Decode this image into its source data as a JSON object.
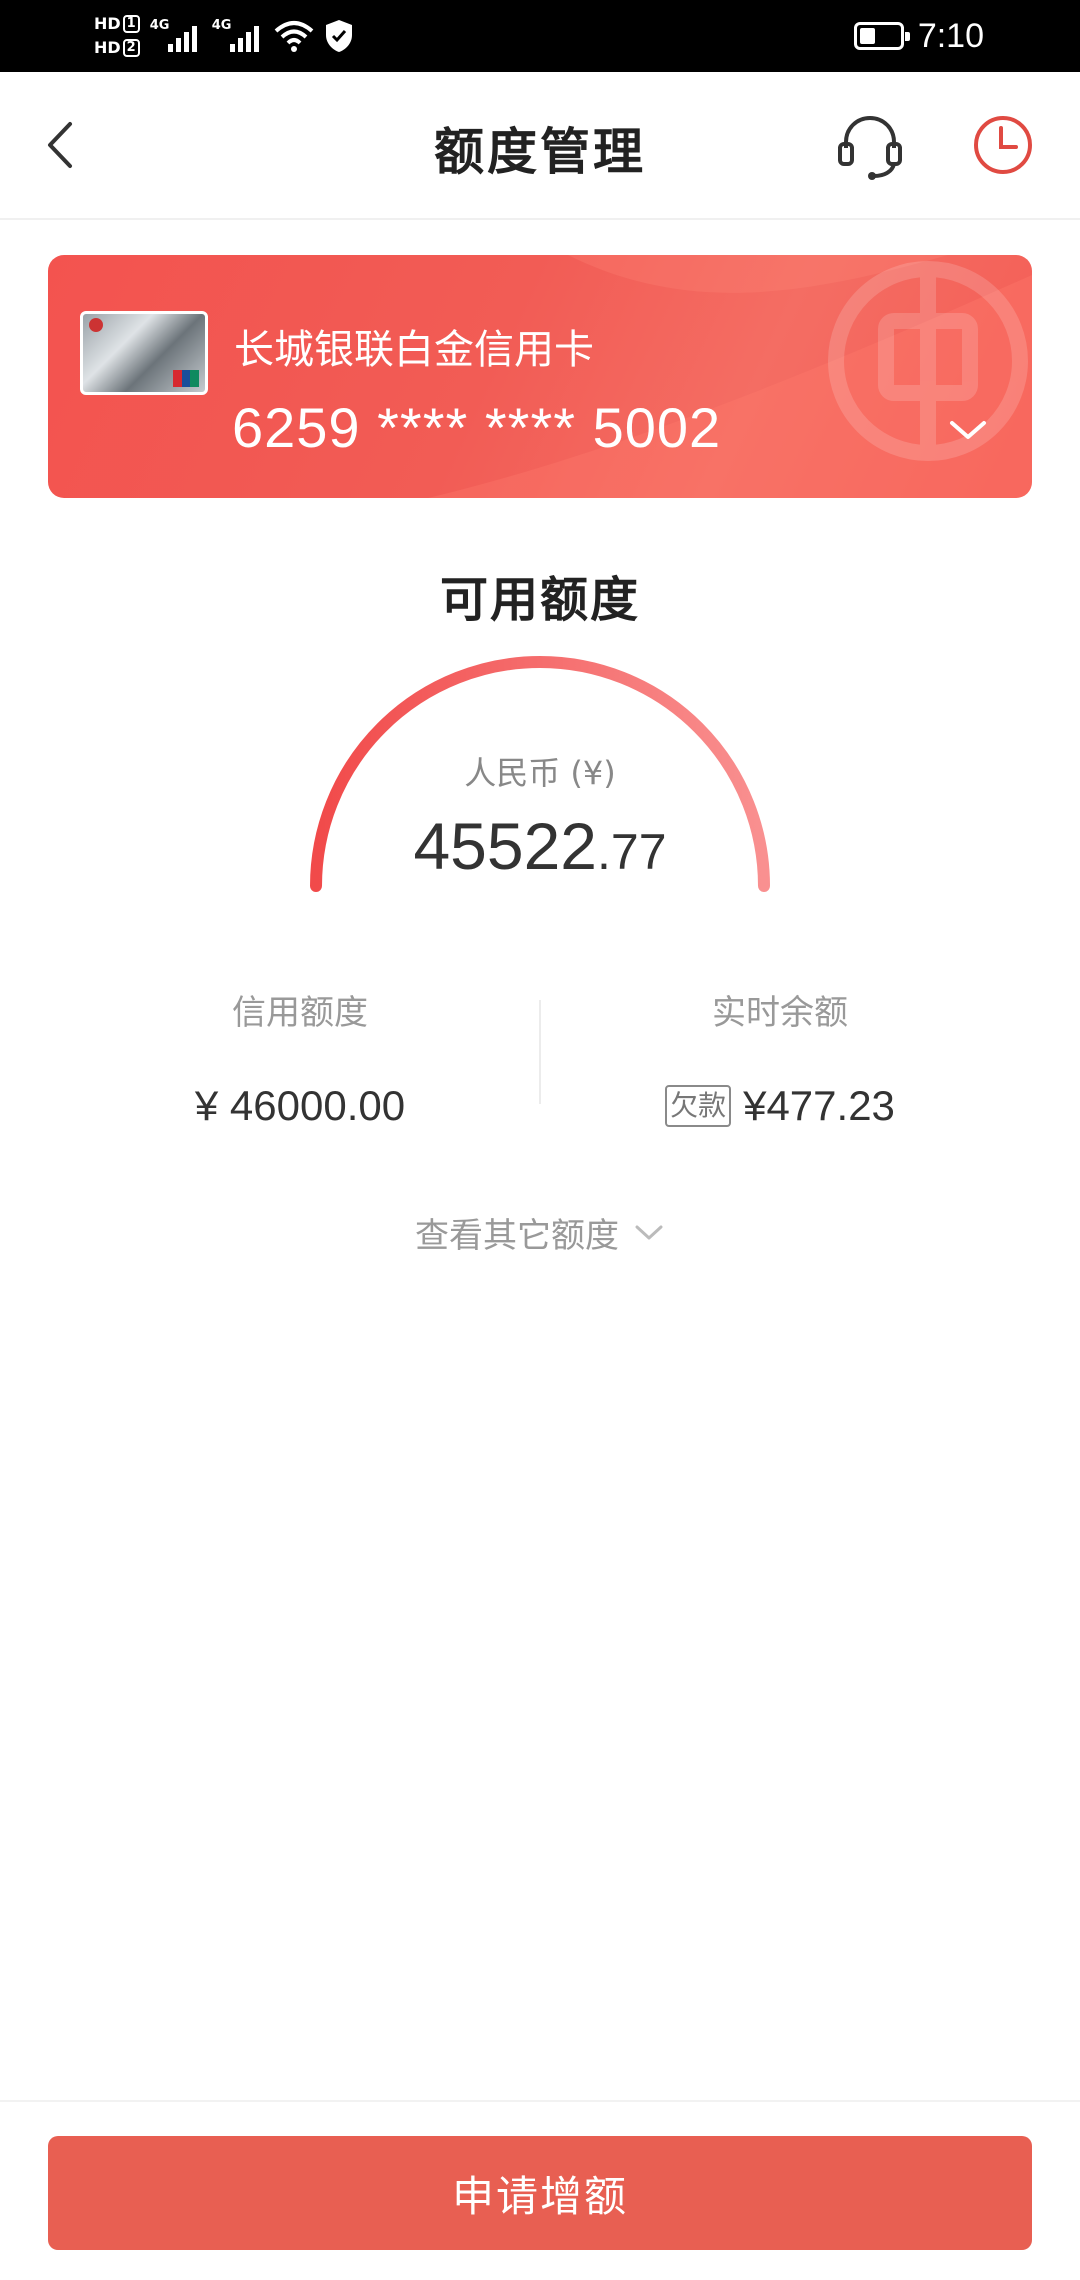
{
  "status_bar": {
    "hd1": "HD",
    "hd1_sub": "1",
    "hd2": "HD",
    "hd2_sub": "2",
    "network1": "4G",
    "network2": "4G",
    "time": "7:10",
    "battery_level": 0.4
  },
  "header": {
    "title": "额度管理"
  },
  "card": {
    "name": "长城银联白金信用卡",
    "number": "6259 **** **** 5002",
    "accent_color": "#f3534f"
  },
  "available": {
    "title": "可用额度",
    "currency_label": "人民币 (¥)",
    "amount_int": "45522",
    "amount_dec": ".77",
    "used_fraction": 0.9896
  },
  "credit_limit": {
    "label": "信用额度",
    "value": "¥ 46000.00"
  },
  "realtime_balance": {
    "label": "实时余额",
    "badge": "欠款",
    "value": "¥477.23"
  },
  "more_link": {
    "label": "查看其它额度"
  },
  "bottom": {
    "apply_label": "申请增额",
    "button_color": "#e85f52"
  }
}
